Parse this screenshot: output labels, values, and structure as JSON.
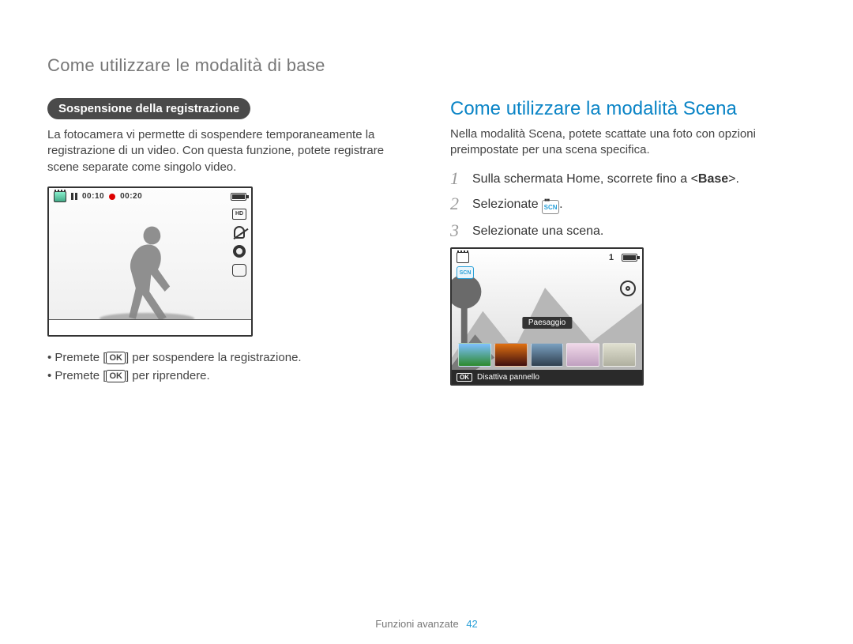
{
  "section_title": "Come utilizzare le modalità di base",
  "left": {
    "pill": "Sospensione della registrazione",
    "paragraph": "La fotocamera vi permette di sospendere temporaneamente la registrazione di un video. Con questa funzione, potete registrare scene separate come singolo video.",
    "lcd": {
      "time_elapsed": "00:10",
      "time_total": "00:20",
      "hd_label": "HD"
    },
    "bullets": {
      "b1_pre": "Premete [",
      "b1_post": "] per sospendere la registrazione.",
      "b2_pre": "Premete [",
      "b2_post": "] per riprendere.",
      "ok": "OK"
    }
  },
  "right": {
    "heading": "Come utilizzare la modalità Scena",
    "paragraph": "Nella modalità Scena, potete scattate una foto con opzioni preimpostate per una scena specifica.",
    "steps": {
      "s1_pre": "Sulla schermata Home, scorrete fino a <",
      "s1_bold": "Base",
      "s1_post": ">.",
      "s2_pre": "Selezionate ",
      "s2_post": ".",
      "s3": "Selezionate una scena."
    },
    "lcd": {
      "scn_label": "SCN",
      "count": "1",
      "tooltip": "Paesaggio",
      "ok": "OK",
      "bottom_text": "Disattiva pannello"
    }
  },
  "footer": {
    "label": "Funzioni avanzate",
    "page": "42"
  }
}
